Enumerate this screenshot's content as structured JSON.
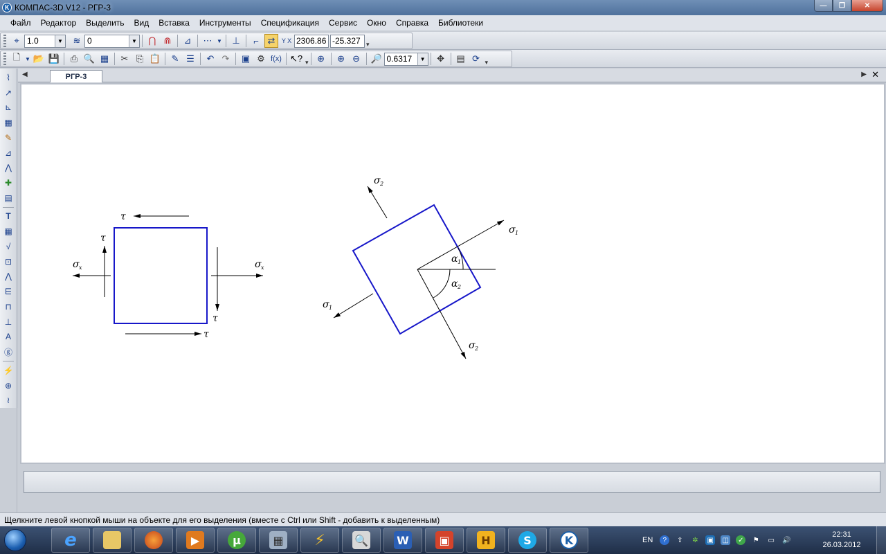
{
  "window": {
    "title": "КОМПАС-3D V12 - РГР-3",
    "logo_letter": "К",
    "min": "—",
    "max": "❐",
    "close": "✕"
  },
  "menu": [
    "Файл",
    "Редактор",
    "Выделить",
    "Вид",
    "Вставка",
    "Инструменты",
    "Спецификация",
    "Сервис",
    "Окно",
    "Справка",
    "Библиотеки"
  ],
  "toolbar1": {
    "step_value": "1.0",
    "layer_value": "0",
    "coord_x": "2306.86",
    "coord_y": "-25.327"
  },
  "toolbar2": {
    "zoom_value": "0.6317"
  },
  "document": {
    "tab_label": "РГР-3",
    "tab_left_arrow": "◀",
    "tab_right_arrow": "▶",
    "tab_close": "✕"
  },
  "drawing": {
    "square": {
      "tau_top": "τ",
      "tau_left": "τ",
      "tau_right": "τ",
      "tau_bottom": "τ",
      "sigma_left": "σ",
      "sigma_left_sub": "x",
      "sigma_right": "σ",
      "sigma_right_sub": "x"
    },
    "rotated": {
      "sigma2_top": "σ",
      "sigma2_top_sub": "2",
      "sigma1_right": "σ",
      "sigma1_right_sub": "1",
      "sigma1_left": "σ",
      "sigma1_left_sub": "1",
      "sigma2_bottom": "σ",
      "sigma2_bottom_sub": "2",
      "alpha1": "α",
      "alpha1_sub": "1",
      "alpha2": "α",
      "alpha2_sub": "2"
    }
  },
  "status": {
    "text": "Щелкните левой кнопкой мыши на объекте для его выделения (вместе с Ctrl или Shift - добавить к выделенным)"
  },
  "taskbar": {
    "apps": [
      "ie-icon",
      "explorer-icon",
      "firefox-icon",
      "media-player-icon",
      "utorrent-icon",
      "calculator-icon",
      "winamp-icon",
      "search-icon",
      "word-icon",
      "presentation-icon",
      "hyperlink-icon",
      "skype-icon",
      "kompas-icon"
    ],
    "lang": "EN",
    "time": "22:31",
    "date": "26.03.2012"
  },
  "colors": {
    "drawing_blue": "#1717c9",
    "line_black": "#000000"
  }
}
